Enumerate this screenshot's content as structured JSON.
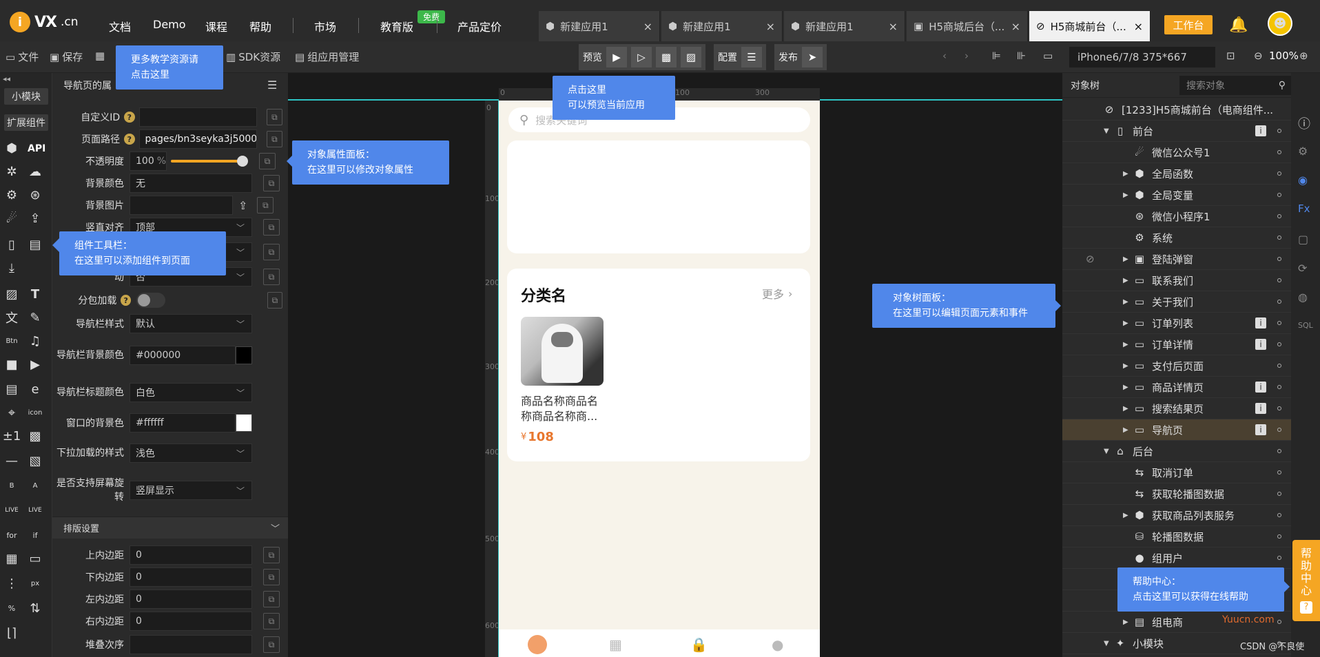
{
  "topbar": {
    "logo_i": "i",
    "logo_vx": "VX",
    "logo_cn": ".cn",
    "nav": [
      "文档",
      "Demo",
      "课程",
      "帮助",
      "市场",
      "教育版",
      "产品定价"
    ],
    "free_badge": "免费",
    "tabs": [
      {
        "label": "新建应用1",
        "close": "×"
      },
      {
        "label": "新建应用1",
        "close": "×"
      },
      {
        "label": "新建应用1",
        "close": "×"
      },
      {
        "label": "H5商城后台（...",
        "close": "×"
      },
      {
        "label": "H5商城前台（...",
        "close": "×"
      }
    ],
    "workbench": "工作台"
  },
  "toolbar": {
    "file": "文件",
    "save": "保存",
    "sdk": "SDK资源",
    "component_mgmt": "组应用管理",
    "preview": "预览",
    "config": "配置",
    "publish": "发布",
    "device": "iPhone6/7/8 375*667",
    "zoom": "100%"
  },
  "leftcol": {
    "small_module": "小模块",
    "ext_component": "扩展组件",
    "api": "API"
  },
  "property_panel": {
    "header": "导航页的属",
    "fields": [
      {
        "label": "自定义ID",
        "value": "",
        "help": true
      },
      {
        "label": "页面路径",
        "value": "pages/bn3seyka3j50000",
        "help": true
      },
      {
        "label": "不透明度",
        "value": "100",
        "unit": "%"
      },
      {
        "label": "背景颜色",
        "value": "无"
      },
      {
        "label": "背景图片",
        "value": ""
      },
      {
        "label": "竖直对齐",
        "value": "顶部"
      },
      {
        "label": "",
        "value": ""
      },
      {
        "label": "动",
        "value": "否"
      },
      {
        "label": "分包加载",
        "value": "",
        "help": true
      },
      {
        "label": "导航栏样式",
        "value": "默认"
      },
      {
        "label": "导航栏背景颜色",
        "value": "#000000"
      },
      {
        "label": "导航栏标题颜色",
        "value": "白色"
      },
      {
        "label": "窗口的背景色",
        "value": "#ffffff"
      },
      {
        "label": "下拉加载的样式",
        "value": "浅色"
      },
      {
        "label": "是否支持屏幕旋转",
        "value": "竖屏显示"
      }
    ],
    "layout_section": "排版设置",
    "layout_fields": [
      {
        "label": "上内边距",
        "value": "0"
      },
      {
        "label": "下内边距",
        "value": "0"
      },
      {
        "label": "左内边距",
        "value": "0"
      },
      {
        "label": "右内边距",
        "value": "0"
      },
      {
        "label": "堆叠次序",
        "value": ""
      }
    ],
    "opacity_level": 1.0
  },
  "phone": {
    "search_placeholder": "搜索关键词",
    "category_title": "分类名",
    "more": "更多",
    "product_name": "商品名称商品名称商品名称商...",
    "price_symbol": "¥",
    "price": "108",
    "ruler_h": [
      "0",
      "100",
      "200",
      "300"
    ],
    "ruler_v": [
      "0",
      "100",
      "200",
      "300",
      "400",
      "500",
      "600"
    ]
  },
  "object_tree": {
    "tab": "对象树",
    "search_placeholder": "搜索对象",
    "root": "[1233]H5商城前台（电商组件...",
    "items": [
      {
        "label": "前台",
        "level": 1,
        "expanded": true,
        "icon": "phone-icon",
        "info": true
      },
      {
        "label": "微信公众号1",
        "level": 2,
        "icon": "wechat-icon"
      },
      {
        "label": "全局函数",
        "level": 2,
        "collapsed": true,
        "icon": "cube-icon"
      },
      {
        "label": "全局变量",
        "level": 2,
        "collapsed": true,
        "icon": "cube-icon"
      },
      {
        "label": "微信小程序1",
        "level": 2,
        "icon": "miniprogram-icon"
      },
      {
        "label": "系统",
        "level": 2,
        "icon": "gear-icon"
      },
      {
        "label": "登陆弹窗",
        "level": 2,
        "collapsed": true,
        "icon": "popup-icon",
        "hidden": true
      },
      {
        "label": "联系我们",
        "level": 2,
        "collapsed": true,
        "icon": "page-icon"
      },
      {
        "label": "关于我们",
        "level": 2,
        "collapsed": true,
        "icon": "page-icon"
      },
      {
        "label": "订单列表",
        "level": 2,
        "collapsed": true,
        "icon": "page-icon",
        "info": true
      },
      {
        "label": "订单详情",
        "level": 2,
        "collapsed": true,
        "icon": "page-icon",
        "info": true
      },
      {
        "label": "支付后页面",
        "level": 2,
        "collapsed": true,
        "icon": "page-icon"
      },
      {
        "label": "商品详情页",
        "level": 2,
        "collapsed": true,
        "icon": "page-icon",
        "info": true
      },
      {
        "label": "搜索结果页",
        "level": 2,
        "collapsed": true,
        "icon": "page-icon",
        "info": true
      },
      {
        "label": "导航页",
        "level": 2,
        "collapsed": true,
        "icon": "page-icon",
        "info": true,
        "selected": true
      },
      {
        "label": "后台",
        "level": 1,
        "expanded": true,
        "icon": "server-icon"
      },
      {
        "label": "取消订单",
        "level": 2,
        "icon": "exchange-icon"
      },
      {
        "label": "获取轮播图数据",
        "level": 2,
        "icon": "exchange-icon"
      },
      {
        "label": "获取商品列表服务",
        "level": 2,
        "collapsed": true,
        "icon": "cube-icon"
      },
      {
        "label": "轮播图数据",
        "level": 2,
        "icon": "db-icon"
      },
      {
        "label": "组用户",
        "level": 2,
        "icon": "user-icon"
      },
      {
        "label": "",
        "level": 2,
        "icon": ""
      },
      {
        "label": "",
        "level": 2,
        "icon": ""
      },
      {
        "label": "组电商",
        "level": 2,
        "collapsed": true,
        "icon": "shop-icon"
      },
      {
        "label": "小模块",
        "level": 1,
        "expanded": true,
        "icon": "puzzle-icon"
      }
    ]
  },
  "tooltips": {
    "teaching": [
      "更多教学资源请",
      "点击这里"
    ],
    "preview": [
      "点击这里",
      "可以预览当前应用"
    ],
    "property": [
      "对象属性面板：",
      "在这里可以修改对象属性"
    ],
    "component": [
      "组件工具栏：",
      "在这里可以添加组件到页面"
    ],
    "tree": [
      "对象树面板：",
      "在这里可以编辑页面元素和事件"
    ],
    "help": [
      "帮助中心：",
      "点击这里可以获得在线帮助"
    ]
  },
  "help_center": [
    "帮",
    "助",
    "中",
    "心",
    "?"
  ],
  "watermark": "Yuucn.com",
  "credit": "CSDN @不良使",
  "colors": {
    "accent": "#f5a623",
    "tooltip": "#5087ea",
    "price": "#e8772e"
  }
}
